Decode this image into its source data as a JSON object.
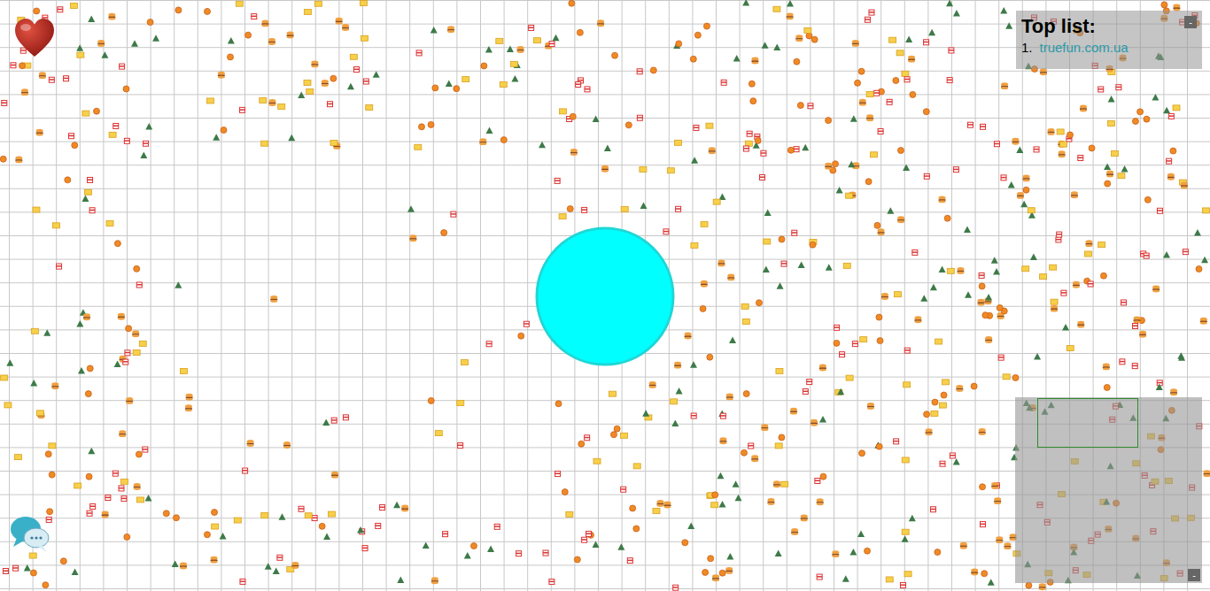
{
  "top_list": {
    "title": "Top list:",
    "entries": [
      {
        "rank": "1.",
        "name": "truefun.com.ua"
      }
    ],
    "minimize": "-"
  },
  "minimap": {
    "minimize": "-"
  }
}
